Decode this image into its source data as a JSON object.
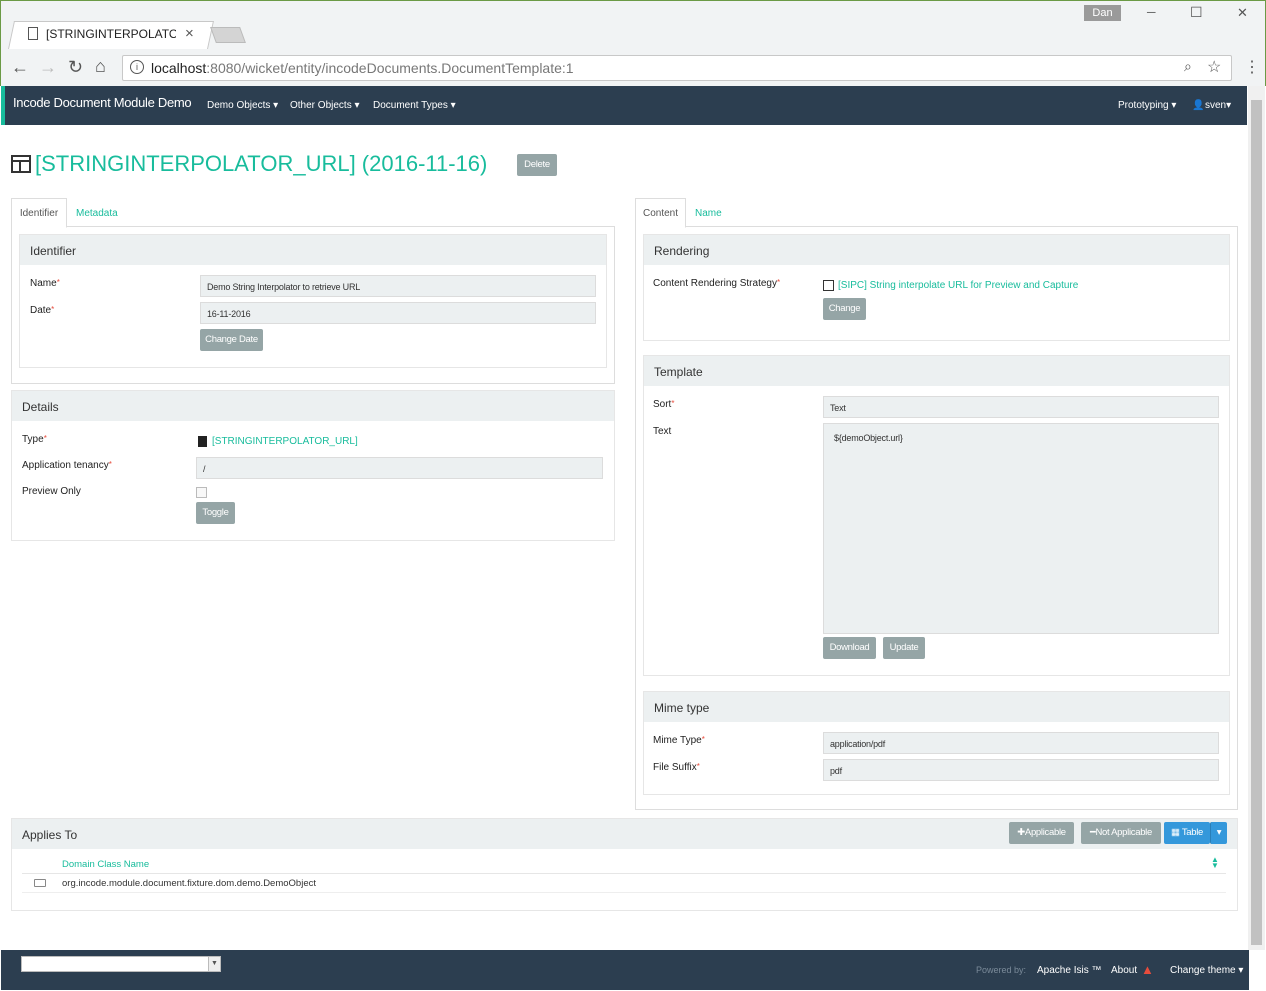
{
  "browser": {
    "tab_title": "[STRINGINTERPOLATOR_",
    "tab_close": "×",
    "url_host": "localhost",
    "url_rest": ":8080/wicket/entity/incodeDocuments.DocumentTemplate:1",
    "user_chip": "Dan",
    "window_minimize": "─",
    "window_maximize": "☐",
    "window_close": "✕"
  },
  "navbar": {
    "brand": "Incode Document Module Demo",
    "menus": [
      "Demo Objects ▾",
      "Other Objects ▾",
      "Document Types ▾"
    ],
    "prototyping": "Prototyping ▾",
    "user": "sven▾"
  },
  "page": {
    "title": "[STRINGINTERPOLATOR_URL] (2016-11-16)",
    "delete_button": "Delete"
  },
  "left": {
    "tabs": [
      "Identifier",
      "Metadata"
    ],
    "identifier_panel": {
      "heading": "Identifier",
      "name_label": "Name",
      "name_value": "Demo String Interpolator to retrieve URL",
      "date_label": "Date",
      "date_value": "16-11-2016",
      "change_date_button": "Change Date"
    },
    "details_panel": {
      "heading": "Details",
      "type_label": "Type",
      "type_value": "[STRINGINTERPOLATOR_URL]",
      "tenancy_label": "Application tenancy",
      "tenancy_value": "/",
      "preview_label": "Preview Only",
      "toggle_button": "Toggle"
    }
  },
  "right": {
    "tabs": [
      "Content",
      "Name"
    ],
    "rendering_panel": {
      "heading": "Rendering",
      "strategy_label": "Content Rendering Strategy",
      "strategy_value": "[SIPC] String interpolate URL for Preview and Capture",
      "change_button": "Change"
    },
    "template_panel": {
      "heading": "Template",
      "sort_label": "Sort",
      "sort_value": "Text",
      "text_label": "Text",
      "text_value": "${demoObject.url}",
      "download_button": "Download",
      "update_button": "Update"
    },
    "mime_panel": {
      "heading": "Mime type",
      "mime_label": "Mime Type",
      "mime_value": "application/pdf",
      "suffix_label": "File Suffix",
      "suffix_value": "pdf"
    }
  },
  "applies_to": {
    "heading": "Applies To",
    "applicable_button": "Applicable",
    "not_applicable_button": "Not Applicable",
    "table_button": "Table",
    "column": "Domain Class Name",
    "rows": [
      "org.incode.module.document.fixture.dom.demo.DemoObject"
    ]
  },
  "footer": {
    "powered_by": "Powered by:",
    "apache_isis": "Apache Isis ™",
    "about": "About",
    "change_theme": "Change theme ▾"
  },
  "colors": {
    "navbar": "#2c3e50",
    "accent": "#18bc9c",
    "button": "#95a5a6",
    "primary_button": "#3498db",
    "panel_head": "#ecf0f1"
  }
}
